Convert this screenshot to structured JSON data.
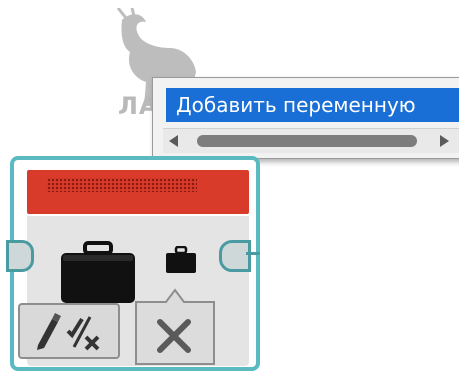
{
  "watermark": {
    "text": "ЛАНЬ"
  },
  "dropdown": {
    "selected_item": "Добавить переменную"
  },
  "block": {
    "input_icon": "briefcase-icon",
    "output_icon": "briefcase-icon",
    "mode_icon": "pencil-check-icon",
    "delete_icon": "close-icon"
  },
  "colors": {
    "header_red": "#d93b2b",
    "border_teal": "#5ab9c1",
    "highlight_blue": "#1a6fd6",
    "body_gray": "#e4e4e4"
  }
}
